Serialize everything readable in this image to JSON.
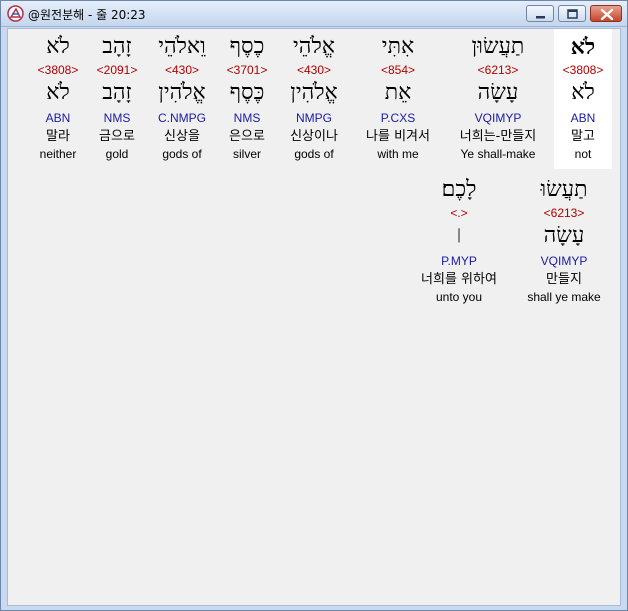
{
  "window": {
    "title": "@원전분해 - 줄 20:23"
  },
  "words_row1": [
    {
      "heb": "לֹא",
      "strong": "<3808>",
      "lemma": "לֹא",
      "morph": "ABN",
      "korean": "말고",
      "english": "not"
    },
    {
      "heb": "תַעֲשׂוּן",
      "strong": "<6213>",
      "lemma": "עָשָׂה",
      "morph": "VQIMYP",
      "korean": "너희는-만들지",
      "english": "Ye shall-make"
    },
    {
      "heb": "אִתִּי",
      "strong": "<854>",
      "lemma": "אֵת",
      "morph": "P.CXS",
      "korean": "나를 비겨서",
      "english": "with me"
    },
    {
      "heb": "אֱלֹהֵי",
      "strong": "<430>",
      "lemma": "אֱלֹהִין",
      "morph": "NMPG",
      "korean": "신상이나",
      "english": "gods of"
    },
    {
      "heb": "כֶסֶף",
      "strong": "<3701>",
      "lemma": "כֶּסֶף",
      "morph": "NMS",
      "korean": "은으로",
      "english": "silver"
    },
    {
      "heb": "וֵאלֹהֵי",
      "strong": "<430>",
      "lemma": "אֱלֹהִין",
      "morph": "C.NMPG",
      "korean": "신상을",
      "english": "gods of"
    },
    {
      "heb": "זָהָב",
      "strong": "<2091>",
      "lemma": "זָהָב",
      "morph": "NMS",
      "korean": "금으로",
      "english": "gold"
    },
    {
      "heb": "לֹא",
      "strong": "<3808>",
      "lemma": "לֹא",
      "morph": "ABN",
      "korean": "말라",
      "english": "neither"
    }
  ],
  "words_row2": [
    {
      "heb": "תַעֲשׂוּ",
      "strong": "<6213>",
      "lemma": "עָשָׂה",
      "morph": "VQIMYP",
      "korean": "만들지",
      "english": "shall ye make"
    },
    {
      "heb": "לָכֶם׃",
      "strong": "<.>",
      "lemma": "׀",
      "morph": "P.MYP",
      "korean": "너희를 위하여",
      "english": "unto you"
    }
  ]
}
